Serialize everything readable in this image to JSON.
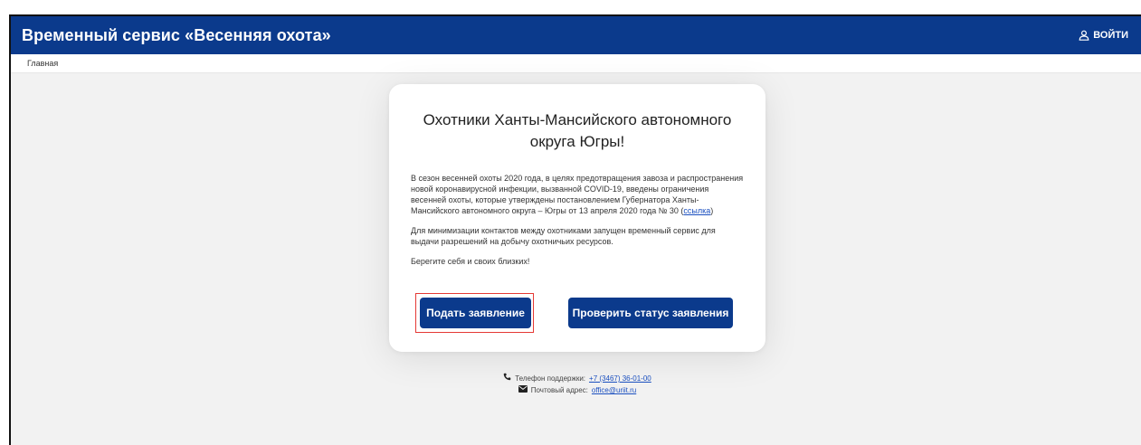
{
  "header": {
    "title": "Временный сервис «Весенняя охота»",
    "login_label": "ВОЙТИ",
    "login_icon": "user-icon"
  },
  "breadcrumb": {
    "home": "Главная"
  },
  "card": {
    "heading": "Охотники Ханты-Мансийского автономного округа Югры!",
    "paragraph1_text": "В сезон весенней охоты 2020 года, в целях предотвращения завоза и распространения новой коронавирусной инфекции, вызванной COVID-19, введены ограничения весенней охоты, которые утверждены постановлением Губернатора Ханты-Мансийского автономного округа – Югры от 13 апреля 2020 года № 30 (",
    "paragraph1_link": "ссылка",
    "paragraph1_end": ")",
    "paragraph2": "Для минимизации контактов между охотниками запущен временный сервис для выдачи разрешений на добычу охотничьих ресурсов.",
    "paragraph3": "Берегите себя и своих близких!",
    "apply_button": "Подать заявление",
    "status_button": "Проверить статус заявления"
  },
  "footer": {
    "phone_label": "Телефон поддержки:",
    "phone_value": "+7 (3467) 36-01-00",
    "email_label": "Почтовый адрес:",
    "email_value": "office@uriit.ru"
  },
  "colors": {
    "brand": "#0b3a8c",
    "highlight": "#e53935",
    "background": "#f2f2f2"
  }
}
